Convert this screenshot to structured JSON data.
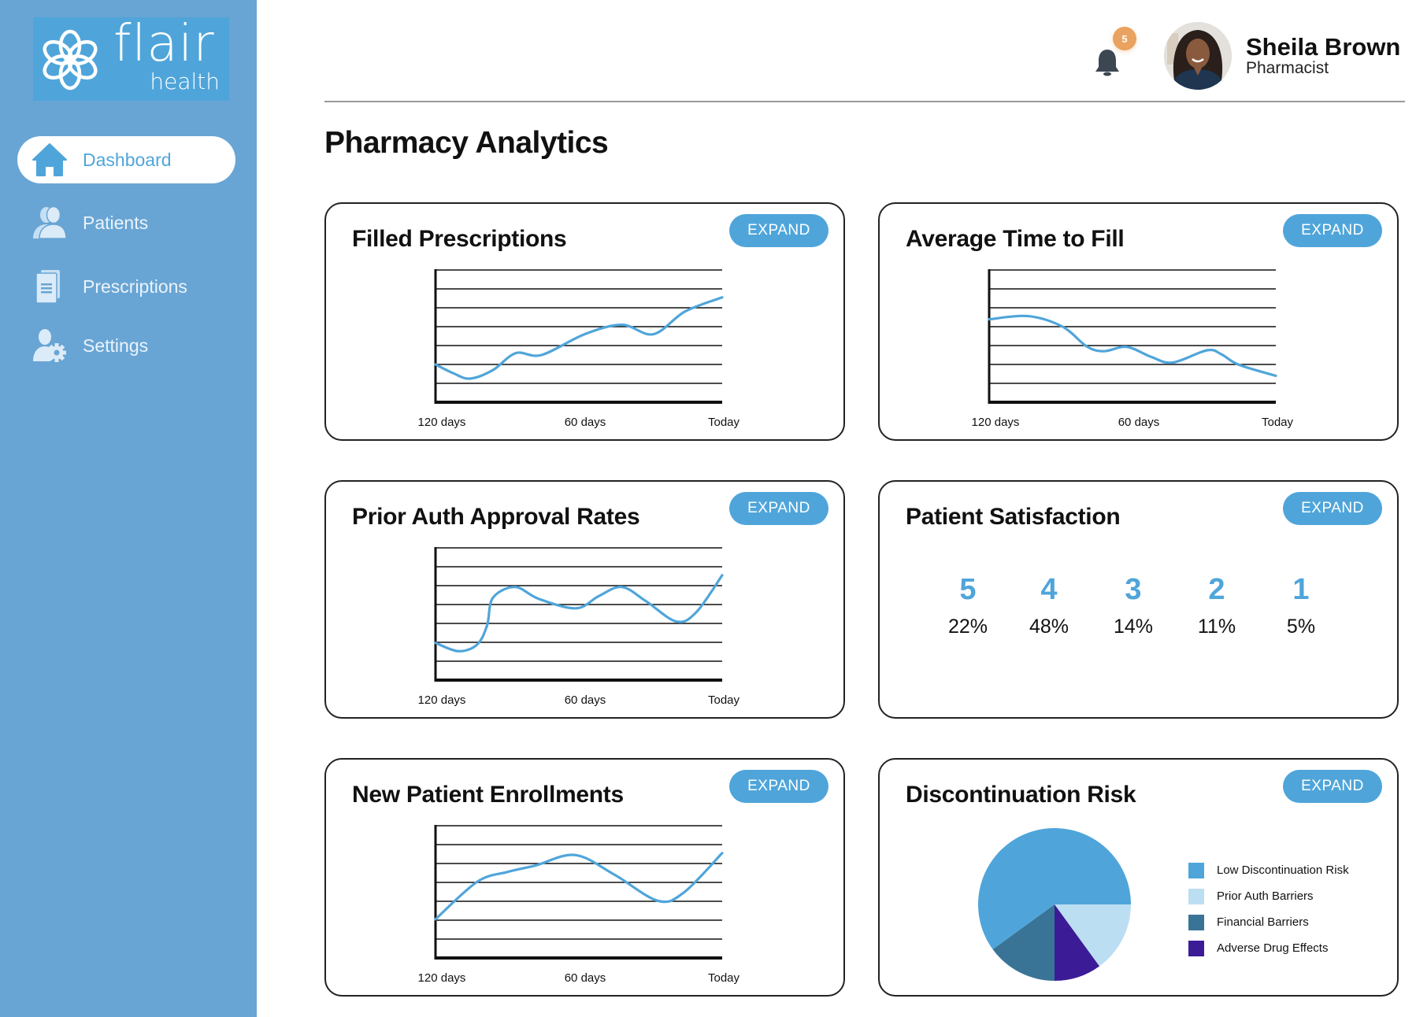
{
  "brand": {
    "name": "flair",
    "sub": "health"
  },
  "sidebar": {
    "items": [
      {
        "label": "Dashboard",
        "icon": "home-icon",
        "active": true
      },
      {
        "label": "Patients",
        "icon": "users-icon",
        "active": false
      },
      {
        "label": "Prescriptions",
        "icon": "documents-icon",
        "active": false
      },
      {
        "label": "Settings",
        "icon": "user-settings-icon",
        "active": false
      }
    ]
  },
  "header": {
    "notifications_count": "5",
    "user": {
      "name": "Sheila Brown",
      "role": "Pharmacist"
    }
  },
  "page": {
    "title": "Pharmacy Analytics"
  },
  "colors": {
    "accent": "#4FA5DA",
    "sidebar": "#68A5D4",
    "badge": "#E9A25F",
    "pie": [
      "#4FA5DA",
      "#BCDEF2",
      "#397497",
      "#3B1C96"
    ]
  },
  "cards": {
    "expand_label": "EXPAND",
    "filled": {
      "title": "Filled Prescriptions"
    },
    "avgtime": {
      "title": "Average Time to Fill"
    },
    "priorauth": {
      "title": "Prior Auth Approval Rates"
    },
    "satisfaction": {
      "title": "Patient Satisfaction"
    },
    "enrollments": {
      "title": "New Patient Enrollments"
    },
    "discontinuation": {
      "title": "Discontinuation Risk"
    }
  },
  "chart_data": [
    {
      "id": "filled",
      "type": "line",
      "title": "Filled Prescriptions",
      "xlabel": "",
      "ylabel": "",
      "x_ticks": [
        "120 days",
        "60 days",
        "Today"
      ],
      "x_range": [
        0,
        1
      ],
      "ylim": [
        0,
        7
      ],
      "grid": true,
      "series": [
        {
          "name": "Filled Prescriptions",
          "x": [
            0,
            0.06,
            0.12,
            0.2,
            0.28,
            0.37,
            0.52,
            0.65,
            0.76,
            0.87,
            1.0
          ],
          "y": [
            2.0,
            1.55,
            1.25,
            1.7,
            2.6,
            2.5,
            3.6,
            4.1,
            3.6,
            4.8,
            5.55
          ]
        }
      ]
    },
    {
      "id": "avgtime",
      "type": "line",
      "title": "Average Time to Fill",
      "xlabel": "",
      "ylabel": "",
      "x_ticks": [
        "120 days",
        "60 days",
        "Today"
      ],
      "x_range": [
        0,
        1
      ],
      "ylim": [
        0,
        7
      ],
      "grid": true,
      "series": [
        {
          "name": "Average Time to Fill",
          "x": [
            0,
            0.136,
            0.256,
            0.34,
            0.4,
            0.48,
            0.565,
            0.64,
            0.76,
            0.81,
            0.87,
            1.0
          ],
          "y": [
            4.39,
            4.56,
            4.0,
            2.96,
            2.7,
            2.93,
            2.4,
            2.1,
            2.75,
            2.54,
            1.99,
            1.4
          ]
        }
      ]
    },
    {
      "id": "priorauth",
      "type": "line",
      "title": "Prior Auth Approval Rates",
      "xlabel": "",
      "ylabel": "",
      "x_ticks": [
        "120 days",
        "60 days",
        "Today"
      ],
      "x_range": [
        0,
        1
      ],
      "ylim": [
        0,
        7
      ],
      "grid": true,
      "series": [
        {
          "name": "Prior Auth Approval Rates",
          "x": [
            0,
            0.08,
            0.145,
            0.18,
            0.2,
            0.277,
            0.36,
            0.49,
            0.57,
            0.65,
            0.735,
            0.84,
            0.91,
            1.0
          ],
          "y": [
            1.97,
            1.53,
            1.88,
            2.9,
            4.35,
            4.93,
            4.3,
            3.8,
            4.45,
            4.93,
            4.17,
            3.1,
            3.6,
            5.55
          ]
        }
      ]
    },
    {
      "id": "enrollments",
      "type": "line",
      "title": "New Patient Enrollments",
      "xlabel": "",
      "ylabel": "",
      "x_ticks": [
        "120 days",
        "60 days",
        "Today"
      ],
      "x_range": [
        0,
        1
      ],
      "ylim": [
        0,
        7
      ],
      "grid": true,
      "series": [
        {
          "name": "New Patient Enrollments",
          "x": [
            0,
            0.145,
            0.25,
            0.35,
            0.487,
            0.625,
            0.775,
            0.865,
            1.0
          ],
          "y": [
            2.05,
            4.03,
            4.55,
            4.9,
            5.45,
            4.4,
            3.03,
            3.45,
            5.55
          ]
        }
      ]
    },
    {
      "id": "satisfaction",
      "type": "table",
      "title": "Patient Satisfaction",
      "categories": [
        "5",
        "4",
        "3",
        "2",
        "1"
      ],
      "values": [
        22,
        48,
        14,
        11,
        5
      ],
      "labels": [
        "22%",
        "48%",
        "14%",
        "11%",
        "5%"
      ]
    },
    {
      "id": "discontinuation",
      "type": "pie",
      "title": "Discontinuation Risk",
      "categories": [
        "Low Discontinuation Risk",
        "Prior Auth Barriers",
        "Financial Barriers",
        "Adverse Drug Effects"
      ],
      "values": [
        60,
        15,
        15,
        10
      ],
      "legend": "right"
    }
  ]
}
